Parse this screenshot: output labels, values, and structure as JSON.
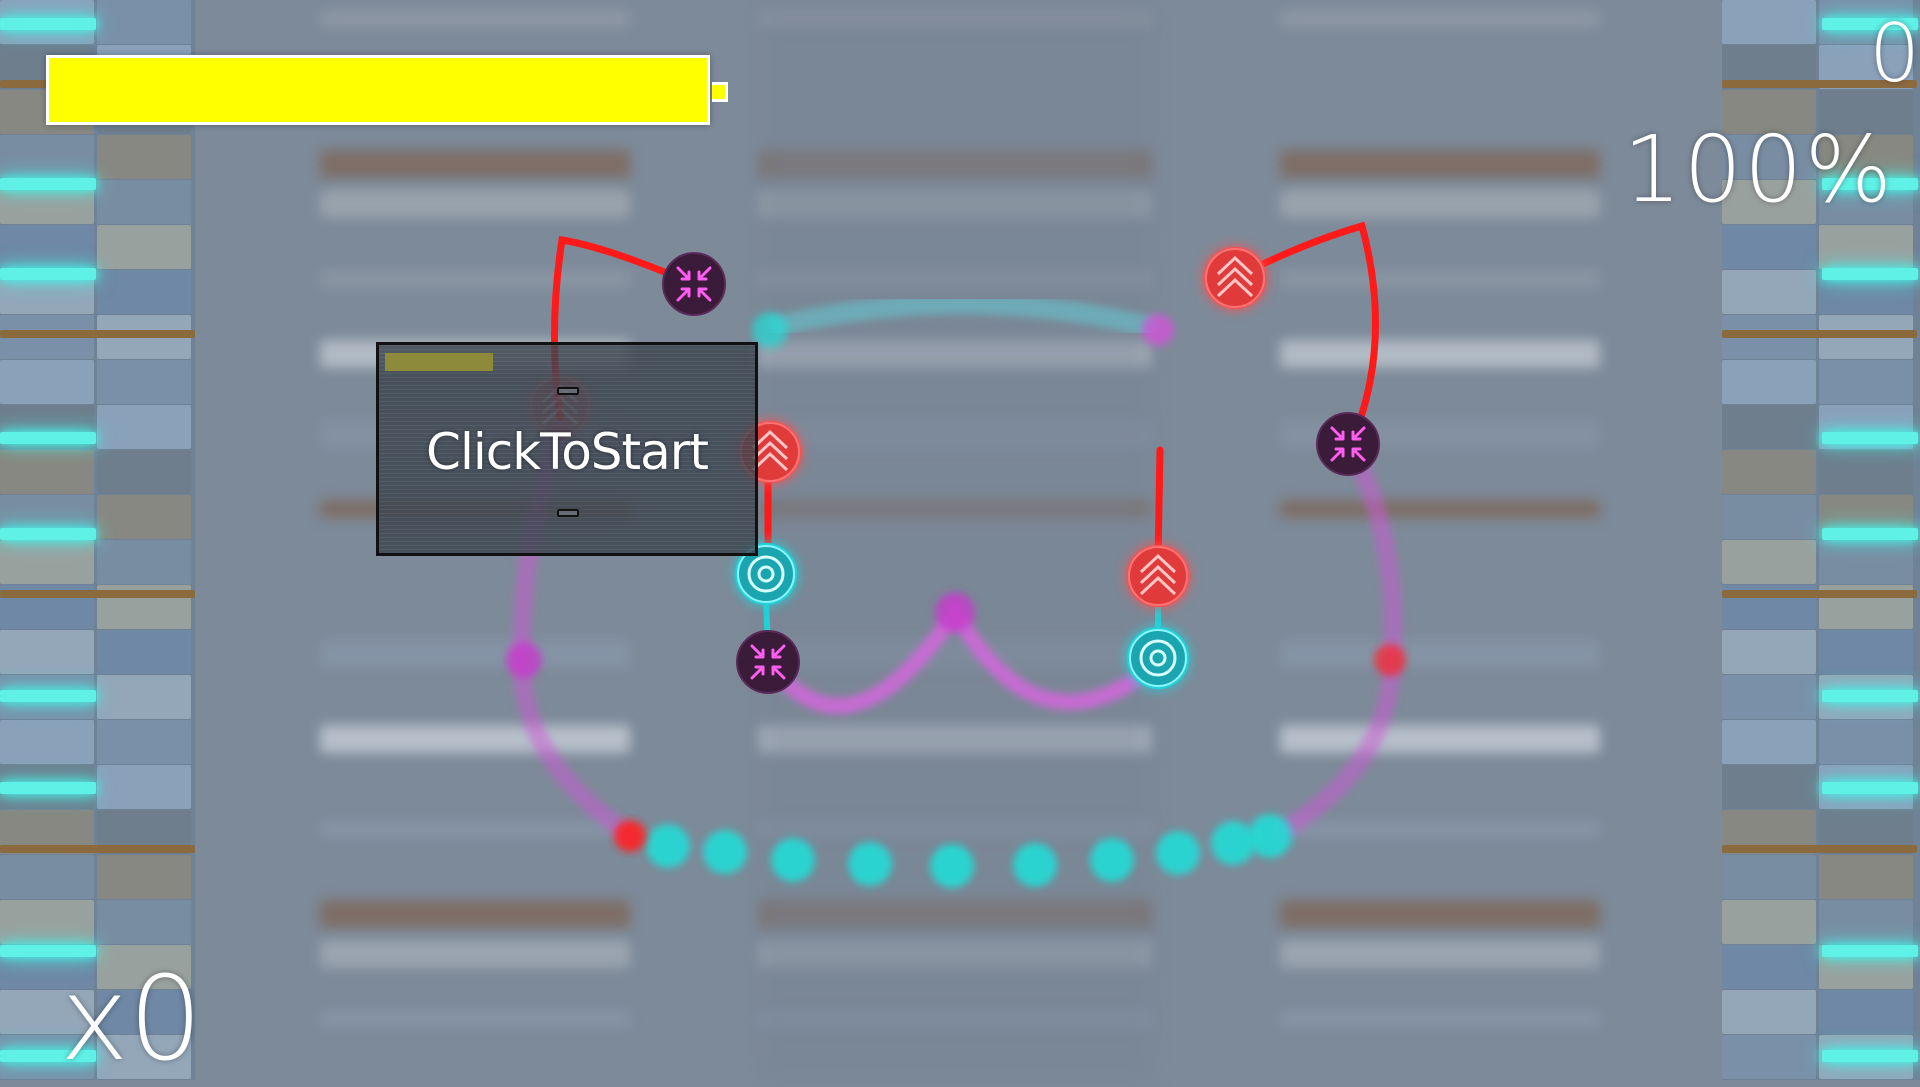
{
  "hud": {
    "score": "0",
    "accuracy": "100%",
    "combo": "x0",
    "health_fraction": 1.0
  },
  "start_button": {
    "label": "ClickToStart"
  },
  "colors": {
    "background": "#7d8a99",
    "health_bar": "#ffff00",
    "red_path": "#ff1a1a",
    "cyan_note": "#22d0d8",
    "magenta_note": "#d055d8",
    "note_dark": "#3a1b3a",
    "side_glow": "#5ff0e6"
  },
  "notes": {
    "icons": [
      "compress-arrows-icon",
      "chevron-up-icon",
      "target-ring-icon"
    ]
  }
}
